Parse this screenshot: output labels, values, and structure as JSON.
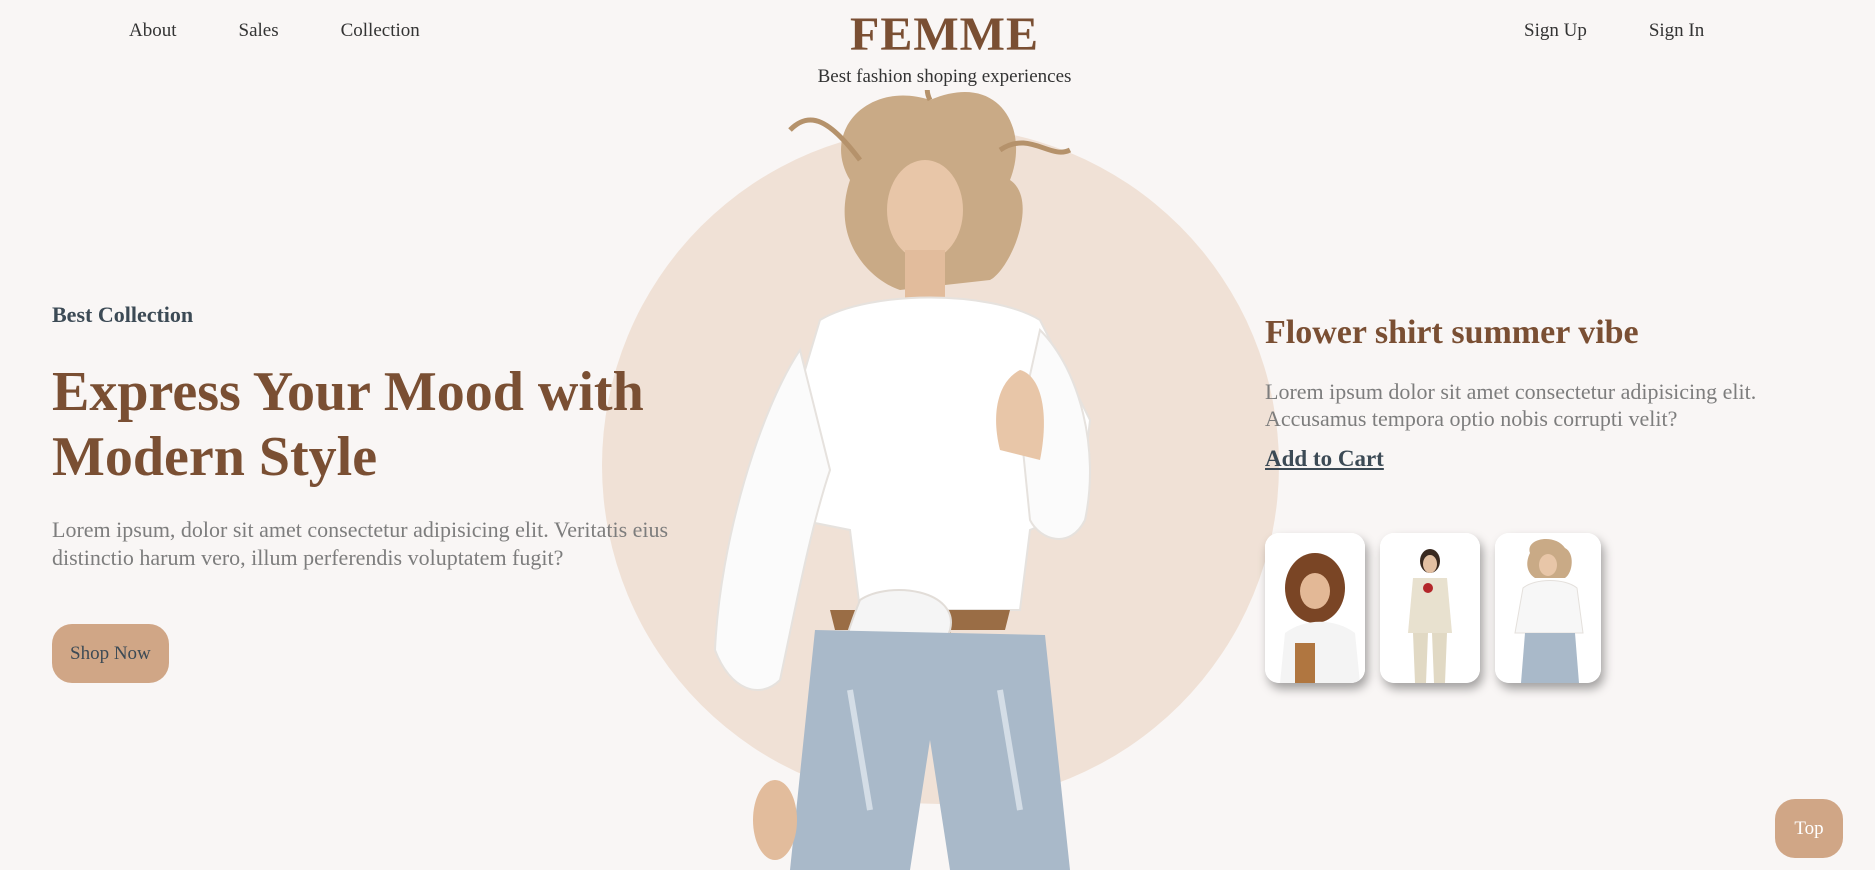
{
  "nav": {
    "left": [
      "About",
      "Sales",
      "Collection"
    ],
    "right": [
      "Sign Up",
      "Sign In"
    ]
  },
  "brand": {
    "name": "FEMME",
    "tagline": "Best fashion shoping experiences"
  },
  "hero": {
    "eyebrow": "Best Collection",
    "headline": "Express Your Mood with Modern Style",
    "body": "Lorem ipsum, dolor sit amet consectetur adipisicing elit. Veritatis eius distinctio harum vero, illum perferendis voluptatem fugit?",
    "cta_label": "Shop Now"
  },
  "product": {
    "title": "Flower shirt summer vibe",
    "description": "Lorem ipsum dolor sit amet consectetur adipisicing elit. Accusamus tempora optio nobis corrupti velit?",
    "add_to_cart_label": "Add to Cart"
  },
  "thumbnails": [
    "curly-hair-model-photo",
    "suit-model-photo",
    "white-shirt-model-photo"
  ],
  "top_button_label": "Top",
  "colors": {
    "brand": "#7a4f33",
    "accent": "#d0a686",
    "circle": "#f0e1d6",
    "background": "#f9f6f5",
    "heading_dark": "#3c4a55",
    "body_text": "#7d7d7d"
  }
}
